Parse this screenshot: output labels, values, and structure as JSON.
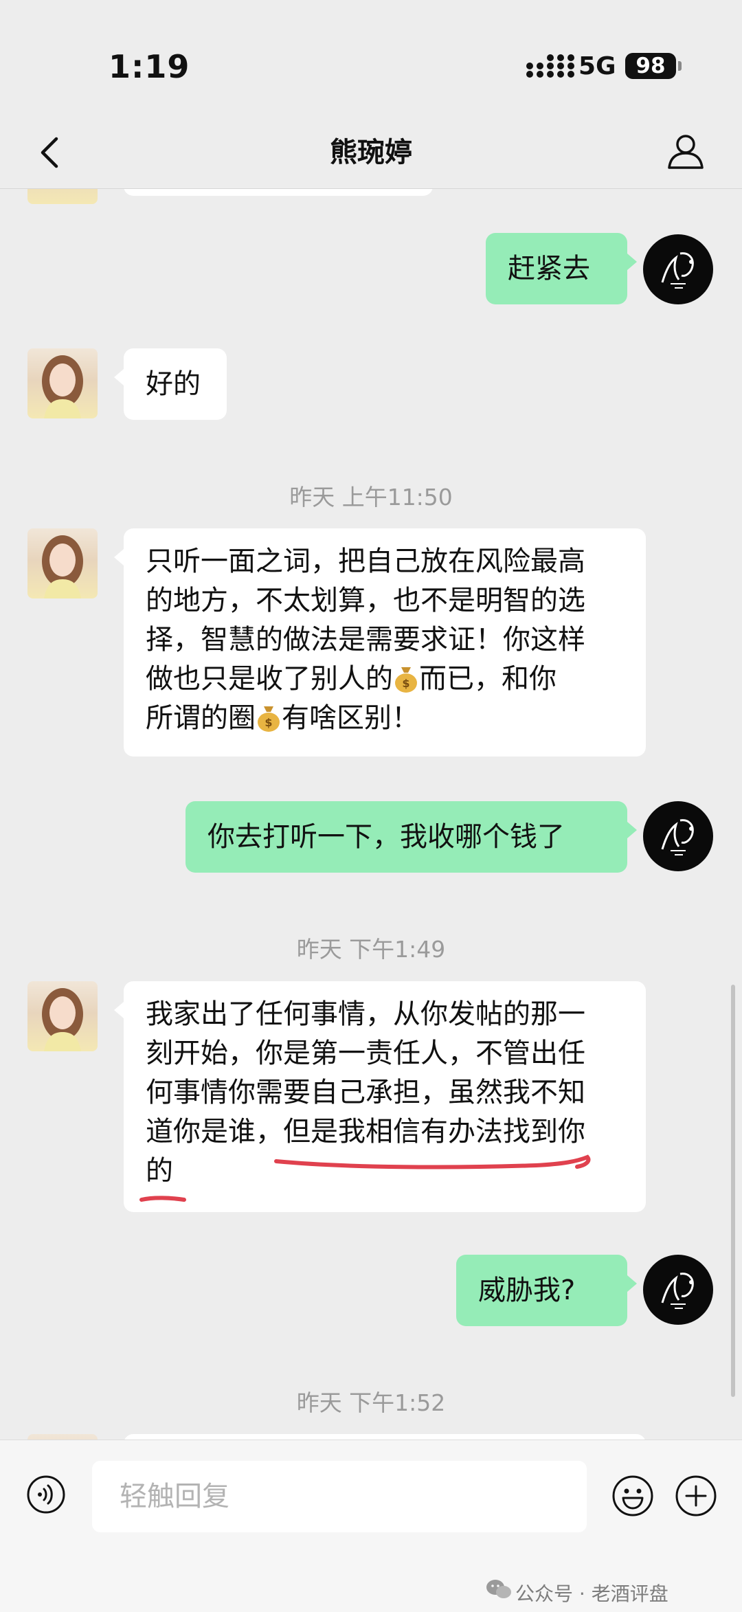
{
  "status_bar": {
    "time": "1:19",
    "network": "5G",
    "battery": "98"
  },
  "nav": {
    "title": "熊琬婷"
  },
  "messages": {
    "m1": "赶紧去",
    "m2": "好的",
    "ts1": "昨天 上午11:50",
    "m3": {
      "l1": "只听一面之词，把自己放在风险最高",
      "l2": "的地方，不太划算，也不是明智的选",
      "l3": "择，智慧的做法是需要求证！你这样",
      "l4a": "做也只是收了别人的",
      "l4b": "而已，和你",
      "l5a": "所谓的圈",
      "l5b": "有啥区别！"
    },
    "m4": "你去打听一下，我收哪个钱了",
    "ts2": "昨天 下午1:49",
    "m5": {
      "l1": "我家出了任何事情，从你发帖的那一",
      "l2": "刻开始，你是第一责任人，不管出任",
      "l3": "何事情你需要自己承担，虽然我不知",
      "l4": "道你是谁，但是我相信有办法找到你",
      "l5": "的"
    },
    "m6": "威胁我?",
    "ts3": "昨天 下午1:52"
  },
  "icons": {
    "money_bag": "money-bag-emoji"
  },
  "colors": {
    "outgoing_bubble": "#95ecb7",
    "incoming_bubble": "#ffffff",
    "underline": "#e0414e"
  },
  "input": {
    "placeholder": "轻触回复"
  },
  "watermark": "公众号 · 老酒评盘"
}
